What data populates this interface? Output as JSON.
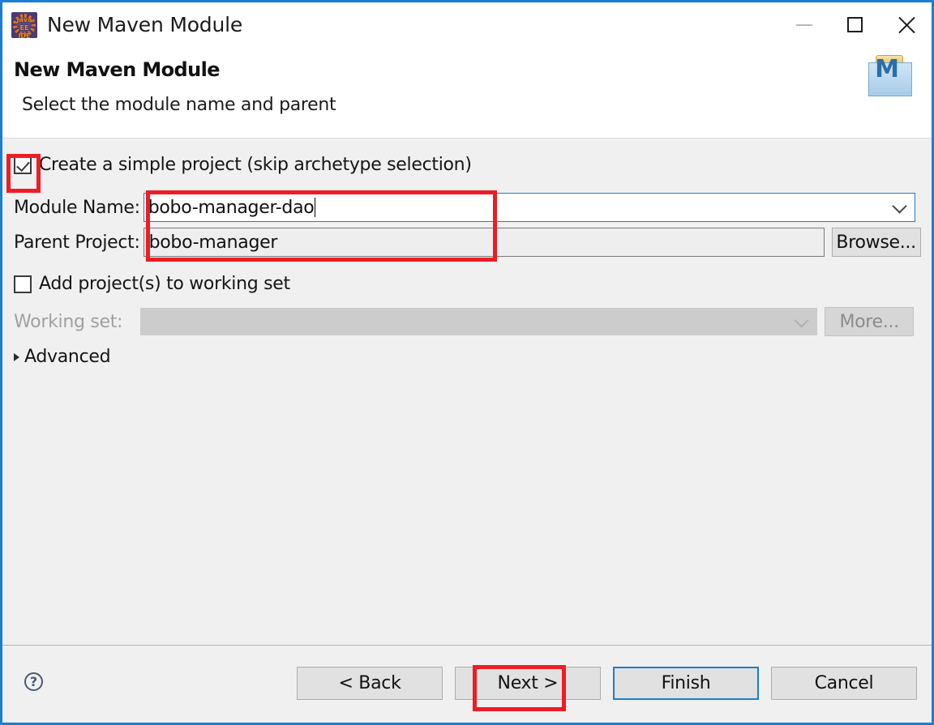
{
  "window": {
    "title": "New Maven Module",
    "app_icon": "eclipse-javaee-ide-icon",
    "minimize_label": "—",
    "maximize_label": "□",
    "close_label": "✕"
  },
  "header": {
    "title": "New Maven Module",
    "subtitle": "Select the module name and parent",
    "icon": "maven-folder-icon",
    "icon_letter": "M"
  },
  "form": {
    "simple_project": {
      "label": "Create a simple project (skip archetype selection)",
      "checked": true
    },
    "module_name": {
      "label": "Module Name:",
      "value": "bobo-manager-dao",
      "dropdown_icon": "chevron-down-icon"
    },
    "parent_project": {
      "label": "Parent Project:",
      "value": "bobo-manager",
      "browse_label": "Browse..."
    },
    "add_to_working_set": {
      "label": "Add project(s) to working set",
      "checked": false
    },
    "working_set": {
      "label": "Working set:",
      "value": "",
      "more_label": "More...",
      "disabled": true
    },
    "advanced": {
      "label": "Advanced",
      "expanded": false,
      "icon": "chevron-right-icon"
    }
  },
  "footer": {
    "help_label": "?",
    "back_label": "< Back",
    "next_label": "Next >",
    "finish_label": "Finish",
    "cancel_label": "Cancel"
  },
  "annotations": {
    "color": "#ef1c24",
    "targets": [
      "simple-project-checkbox",
      "module-and-parent-fields",
      "next-button"
    ]
  }
}
